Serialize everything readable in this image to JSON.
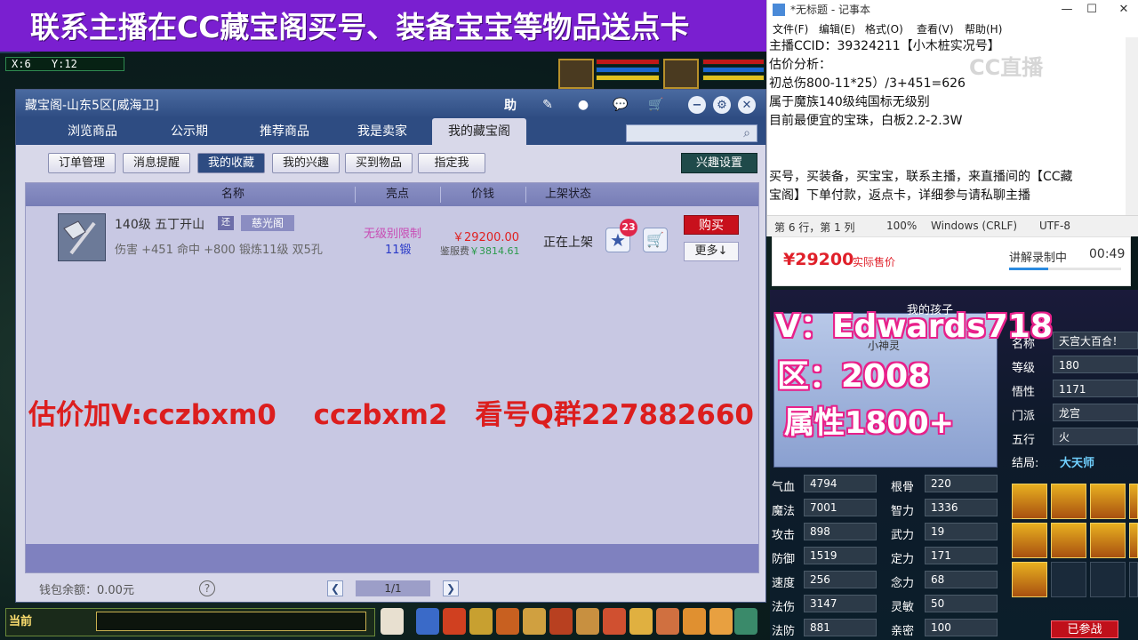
{
  "banner": {
    "text": "联系主播在CC藏宝阁买号、装备宝宝等物品送点卡"
  },
  "game": {
    "coords": {
      "x_label": "X:6",
      "y_label": "Y:12"
    },
    "chat": {
      "channel_label": "当前"
    }
  },
  "window": {
    "title": "藏宝阁-山东5区[威海卫]",
    "toolbar": {
      "help_label": "助"
    },
    "tabs": [
      {
        "label": "浏览商品"
      },
      {
        "label": "公示期"
      },
      {
        "label": "推荐商品"
      },
      {
        "label": "我是卖家"
      },
      {
        "label": "我的藏宝阁"
      }
    ],
    "subtabs": [
      {
        "label": "订单管理"
      },
      {
        "label": "消息提醒"
      },
      {
        "label": "我的收藏"
      },
      {
        "label": "我的兴趣"
      },
      {
        "label": "买到物品"
      },
      {
        "label": "指定我"
      }
    ],
    "interest_settings_label": "兴趣设置",
    "columns": {
      "name": "名称",
      "highlight": "亮点",
      "price": "价钱",
      "status": "上架状态"
    },
    "item": {
      "name": "140级 五丁开山",
      "tag": "还",
      "location": "慈光阁",
      "stats": "伤害 +451 命中 +800 锻炼11级 双5孔",
      "restriction": "无级别限制",
      "level": "11锻",
      "price": "￥29200.00",
      "fee_label": "鉴服费",
      "fee_value": "￥3814.61",
      "status": "正在上架",
      "fav_count": "23",
      "buy_label": "购买",
      "more_label": "更多↓"
    },
    "overlay_text": "估价加V:cczbxm0　 cczbxm2　看号Q群227882660",
    "wallet_label": "钱包余额：0.00元",
    "pagination": "1/1"
  },
  "notepad": {
    "title": "*无标题 - 记事本",
    "menu": [
      "文件(F)",
      "编辑(E)",
      "格式(O)",
      "查看(V)",
      "帮助(H)"
    ],
    "lines": [
      "主播CCID：39324211【小木桩实况号】",
      "估价分析：",
      "初总伤800-11*25）/3+451=626",
      "属于魔族140级纯国标无级别",
      "目前最便宜的宝珠，白板2.2-2.3W",
      "",
      "",
      "买号，买装备，买宝宝，联系主播，来直播间的【CC藏",
      "宝阁】下单付款，返点卡，详细参与请私聊主播"
    ],
    "watermark": "CC直播",
    "status": {
      "position": "第 6 行，第 1 列",
      "zoom": "100%",
      "eol": "Windows (CRLF)",
      "encoding": "UTF-8"
    }
  },
  "price_strip": {
    "price": "¥29200",
    "label": "实际售价",
    "recording_label": "讲解录制中",
    "time": "00:49",
    "progress": 0.35
  },
  "character": {
    "subtitle": "我的孩子",
    "pet_label": "小神灵",
    "promo_v": "V：Edwards718",
    "promo_zone": "区：2008",
    "promo_attr": "属性1800+",
    "info": [
      {
        "label": "名称",
        "value": "天宫大百合！"
      },
      {
        "label": "等级",
        "value": "180"
      },
      {
        "label": "悟性",
        "value": "1171"
      },
      {
        "label": "门派",
        "value": "龙宫"
      },
      {
        "label": "五行",
        "value": "火"
      }
    ],
    "sect_label": "结局:",
    "sect_value": "大天师",
    "stats_left": [
      {
        "label": "气血",
        "value": "4794"
      },
      {
        "label": "魔法",
        "value": "7001"
      },
      {
        "label": "攻击",
        "value": "898"
      },
      {
        "label": "防御",
        "value": "1519"
      },
      {
        "label": "速度",
        "value": "256"
      },
      {
        "label": "法伤",
        "value": "3147"
      },
      {
        "label": "法防",
        "value": "881"
      }
    ],
    "stats_right": [
      {
        "label": "根骨",
        "value": "220"
      },
      {
        "label": "智力",
        "value": "1336"
      },
      {
        "label": "武力",
        "value": "19"
      },
      {
        "label": "定力",
        "value": "171"
      },
      {
        "label": "念力",
        "value": "68"
      },
      {
        "label": "灵敏",
        "value": "50"
      },
      {
        "label": "亲密",
        "value": "100"
      }
    ],
    "joined_label": "已参战"
  },
  "colors": {
    "accent": "#2e4c82",
    "banner": "#7a1fd0",
    "price_red": "#e0202a",
    "buy_red": "#c8101c"
  }
}
